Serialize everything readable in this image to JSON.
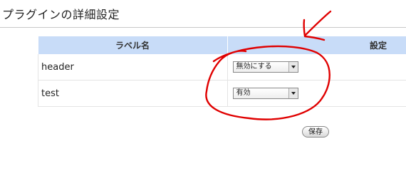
{
  "page": {
    "title": "プラグインの詳細設定"
  },
  "table": {
    "headers": {
      "label": "ラベル名",
      "setting": "設定"
    },
    "rows": [
      {
        "label": "header",
        "selected": "無効にする"
      },
      {
        "label": "test",
        "selected": "有効"
      }
    ]
  },
  "actions": {
    "save_label": "保存"
  },
  "annotation": {
    "color": "#e00000"
  }
}
